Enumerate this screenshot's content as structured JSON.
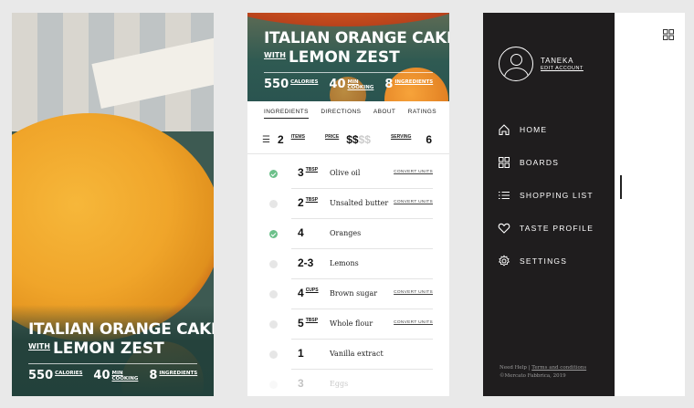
{
  "recipe": {
    "title_line1": "ITALIAN ORANGE CAKE",
    "with": "WITH",
    "title_line2": "LEMON ZEST",
    "stats": [
      {
        "num": "550",
        "label": "CALORIES"
      },
      {
        "num": "40",
        "label": "MIN COOKING"
      },
      {
        "num": "8",
        "label": "INGREDIENTS"
      }
    ]
  },
  "detail": {
    "tabs": [
      "INGREDIENTS",
      "DIRECTIONS",
      "ABOUT",
      "RATINGS"
    ],
    "items_num": "2",
    "items_label": "ITEMS",
    "price_label": "PRICE",
    "price_on": "$$",
    "price_off": "$$",
    "serving_label": "SERVING",
    "serving_num": "6",
    "ingredients": [
      {
        "qty": "3",
        "unit": "TBSP",
        "name": "Olive oil",
        "convert": "CONVERT UNITS",
        "checked": true
      },
      {
        "qty": "2",
        "unit": "TBSP",
        "name": "Unsalted butter",
        "convert": "CONVERT UNITS",
        "checked": false
      },
      {
        "qty": "4",
        "unit": "",
        "name": "Oranges",
        "convert": "",
        "checked": true
      },
      {
        "qty": "2-3",
        "unit": "",
        "name": "Lemons",
        "convert": "",
        "checked": false
      },
      {
        "qty": "4",
        "unit": "CUPS",
        "name": "Brown sugar",
        "convert": "CONVERT UNITS",
        "checked": false
      },
      {
        "qty": "5",
        "unit": "TBSP",
        "name": "Whole flour",
        "convert": "CONVERT UNITS",
        "checked": false
      },
      {
        "qty": "1",
        "unit": "",
        "name": "Vanilla extract",
        "convert": "",
        "checked": false
      },
      {
        "qty": "3",
        "unit": "",
        "name": "Eggs",
        "convert": "",
        "checked": false
      }
    ]
  },
  "menu": {
    "user": "TANEKA",
    "edit": "EDIT ACCOUNT",
    "items": [
      {
        "label": "HOME",
        "icon": "home-icon"
      },
      {
        "label": "BOARDS",
        "icon": "boards-icon"
      },
      {
        "label": "SHOPPING LIST",
        "icon": "list-icon"
      },
      {
        "label": "TASTE PROFILE",
        "icon": "heart-icon"
      },
      {
        "label": "SETTINGS",
        "icon": "gear-icon"
      }
    ],
    "help": "Need Help | ",
    "terms": "Terms and conditions",
    "copyright": "©Mercato Fabbrica, 2019"
  }
}
